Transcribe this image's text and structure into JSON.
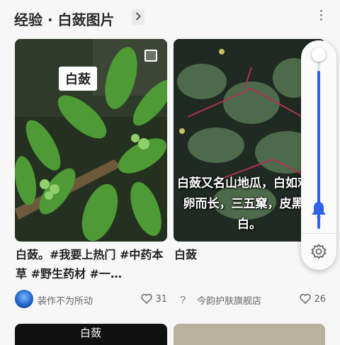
{
  "header": {
    "title": "经验 · 白蔹图片"
  },
  "feed": {
    "cards": [
      {
        "tag": "白蔹",
        "caption": "白蔹。#我要上热门 #中药本草 #野生药材 #一…",
        "author": "装作不为所动",
        "likes": "31"
      },
      {
        "overlay_text": "白蔹又名山地瓜，白如鸡鸭卵而长，三五窠，皮黑肉白。",
        "caption": "白蔹",
        "author": "今韵护肤旗舰店",
        "likes": "26"
      }
    ],
    "next_row": {
      "card1_label": "白蔹"
    }
  },
  "volume_panel": {
    "level": 0.92,
    "accent_color": "#2f62e8",
    "icons": [
      "bell-icon",
      "gear-icon"
    ]
  }
}
